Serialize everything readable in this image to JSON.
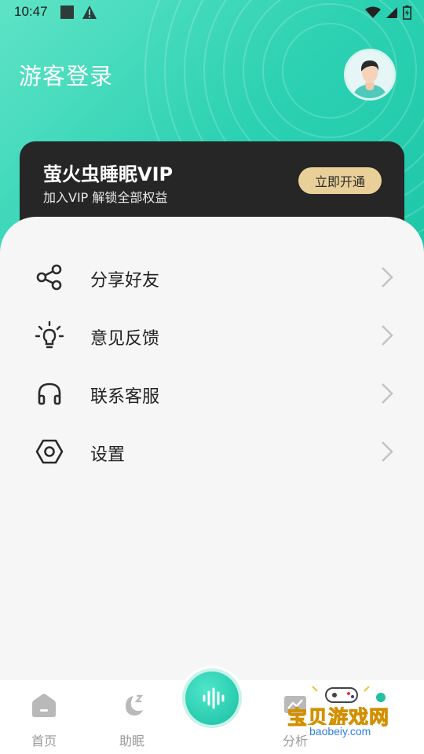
{
  "status_bar": {
    "time": "10:47"
  },
  "header": {
    "title": "游客登录"
  },
  "vip": {
    "title": "萤火虫睡眠VIP",
    "subtitle": "加入VIP 解锁全部权益",
    "button_label": "立即开通"
  },
  "menu": {
    "items": [
      {
        "label": "分享好友",
        "icon": "share-icon"
      },
      {
        "label": "意见反馈",
        "icon": "lightbulb-icon"
      },
      {
        "label": "联系客服",
        "icon": "headphones-icon"
      },
      {
        "label": "设置",
        "icon": "hexagon-settings-icon"
      }
    ]
  },
  "tab_bar": {
    "tabs": [
      {
        "label": "首页",
        "icon": "home-icon"
      },
      {
        "label": "助眠",
        "icon": "moon-icon"
      },
      {
        "label": "",
        "icon": "sound-wave-icon"
      },
      {
        "label": "分析",
        "icon": "analysis-icon"
      }
    ]
  },
  "watermark": {
    "text": "宝贝游戏网",
    "url": "baobeiy.com"
  },
  "colors": {
    "accent": "#2bd1b2",
    "vip_gold": "#e9cf98",
    "card_dark": "#262626"
  }
}
